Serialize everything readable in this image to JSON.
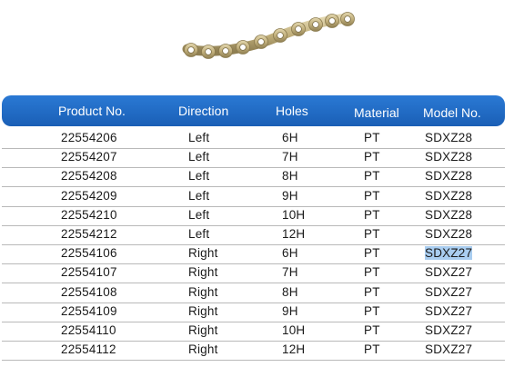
{
  "table": {
    "headers": {
      "product_no": "Product No.",
      "direction": "Direction",
      "holes": "Holes",
      "material": "Material",
      "model_no": "Model No."
    },
    "rows": [
      {
        "product_no": "22554206",
        "direction": "Left",
        "holes": "6H",
        "material": "PT",
        "model_no": "SDXZ28"
      },
      {
        "product_no": "22554207",
        "direction": "Left",
        "holes": "7H",
        "material": "PT",
        "model_no": "SDXZ28"
      },
      {
        "product_no": "22554208",
        "direction": "Left",
        "holes": "8H",
        "material": "PT",
        "model_no": "SDXZ28"
      },
      {
        "product_no": "22554209",
        "direction": "Left",
        "holes": "9H",
        "material": "PT",
        "model_no": "SDXZ28"
      },
      {
        "product_no": "22554210",
        "direction": "Left",
        "holes": "10H",
        "material": "PT",
        "model_no": "SDXZ28"
      },
      {
        "product_no": "22554212",
        "direction": "Left",
        "holes": "12H",
        "material": "PT",
        "model_no": "SDXZ28"
      },
      {
        "product_no": "22554106",
        "direction": "Right",
        "holes": "6H",
        "material": "PT",
        "model_no": "SDXZ27"
      },
      {
        "product_no": "22554107",
        "direction": "Right",
        "holes": "7H",
        "material": "PT",
        "model_no": "SDXZ27"
      },
      {
        "product_no": "22554108",
        "direction": "Right",
        "holes": "8H",
        "material": "PT",
        "model_no": "SDXZ27"
      },
      {
        "product_no": "22554109",
        "direction": "Right",
        "holes": "9H",
        "material": "PT",
        "model_no": "SDXZ27"
      },
      {
        "product_no": "22554110",
        "direction": "Right",
        "holes": "10H",
        "material": "PT",
        "model_no": "SDXZ27"
      },
      {
        "product_no": "22554112",
        "direction": "Right",
        "holes": "12H",
        "material": "PT",
        "model_no": "SDXZ27"
      }
    ]
  },
  "colors": {
    "header_bg": "#1f66c1",
    "header_text": "#ffffff",
    "row_divider": "#b9b9b9",
    "selection": "#a9cdf0",
    "plate": "#c9b98a"
  }
}
